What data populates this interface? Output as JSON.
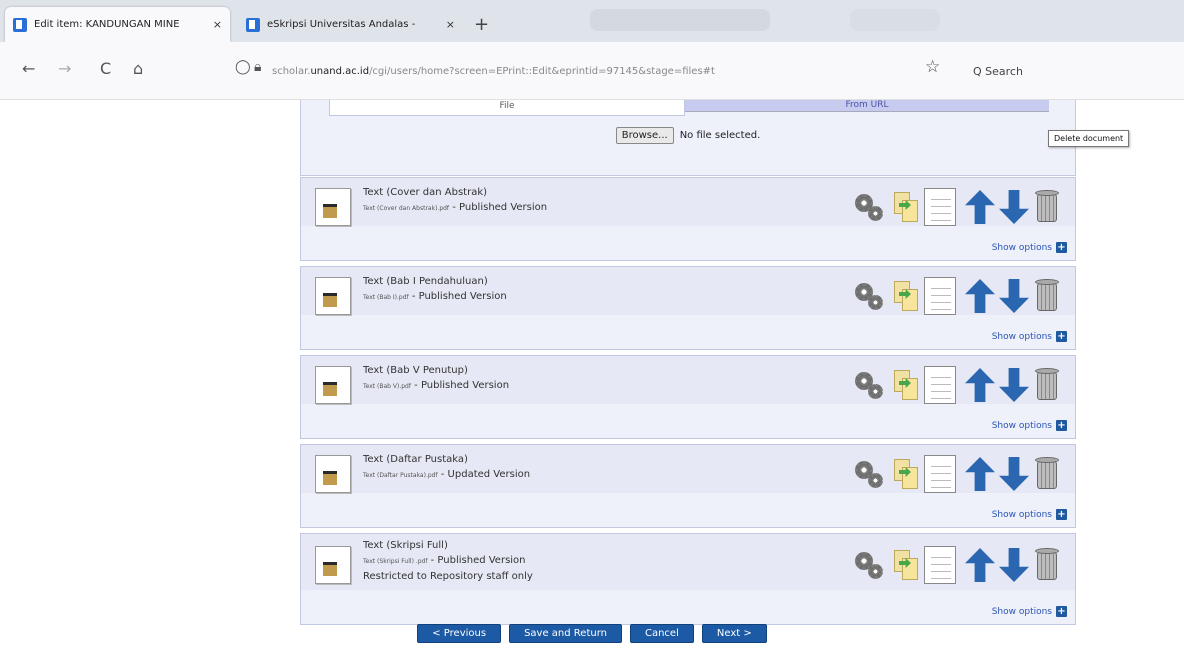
{
  "browser": {
    "tabs": [
      {
        "title": "Edit item: KANDUNGAN MINE",
        "close": "×"
      },
      {
        "title": "eSkripsi Universitas Andalas - ",
        "close": "×"
      }
    ],
    "new_tab": "+",
    "nav": {
      "back": "←",
      "forward": "→",
      "reload": "C",
      "home": "⌂"
    },
    "url_prefix": "scholar.",
    "url_host": "unand.ac.id",
    "url_path": "/cgi/users/home?screen=EPrint::Edit&eprintid=97145&stage=files#t",
    "star": "☆",
    "search_placeholder": "Q Search"
  },
  "upload": {
    "tab_file": "File",
    "tab_url": "From URL",
    "browse_label": "Browse...",
    "no_file": "No file selected."
  },
  "documents": [
    {
      "title": "Text (Cover dan Abstrak)",
      "filename": "Text (Cover dan Abstrak).pdf",
      "version": " - Published Version",
      "restriction": "",
      "show_options": "Show options"
    },
    {
      "title": "Text (Bab I Pendahuluan)",
      "filename": "Text (Bab I).pdf",
      "version": " - Published Version",
      "restriction": "",
      "show_options": "Show options"
    },
    {
      "title": "Text (Bab V Penutup)",
      "filename": "Text (Bab V).pdf",
      "version": " - Published Version",
      "restriction": "",
      "show_options": "Show options"
    },
    {
      "title": "Text (Daftar Pustaka)",
      "filename": "Text (Daftar Pustaka).pdf",
      "version": " - Updated Version",
      "restriction": "",
      "show_options": "Show options"
    },
    {
      "title": "Text (Skripsi Full)",
      "filename": "Text (Skripsi Full) .pdf",
      "version": " - Published Version",
      "restriction": "Restricted to Repository staff only",
      "show_options": "Show options"
    }
  ],
  "tooltip": "Delete document",
  "buttons": {
    "previous": "< Previous",
    "save_return": "Save and Return",
    "cancel": "Cancel",
    "next": "Next >"
  },
  "colors": {
    "accent": "#1c5aa6",
    "panel_bg": "#eef0fa",
    "link": "#2a56b8"
  }
}
